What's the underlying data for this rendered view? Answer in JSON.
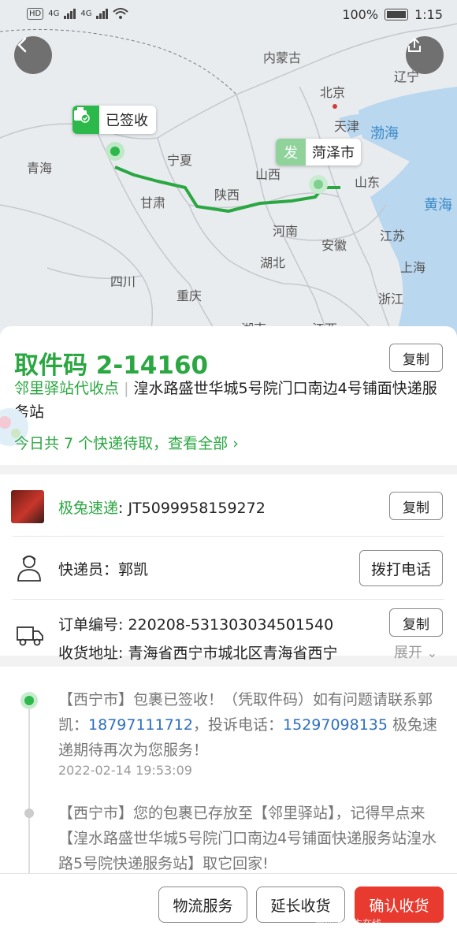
{
  "status_bar": {
    "network_left": "4G",
    "network_right": "4G",
    "battery": "100%",
    "time": "1:15"
  },
  "map": {
    "labels": {
      "neimenggu": "内蒙古",
      "beijing": "北京",
      "liaoning": "辽宁",
      "tianjin": "天津",
      "bohai": "渤海",
      "qinghai": "青海",
      "ningxia": "宁夏",
      "shanxi_jin": "山西",
      "shandong": "山东",
      "huanghai": "黄海",
      "gansu": "甘肃",
      "shaanxi": "陕西",
      "henan": "河南",
      "jiangsu": "江苏",
      "anhui": "安徽",
      "hubei": "湖北",
      "shanghai": "上海",
      "sichuan": "四川",
      "chongqing": "重庆",
      "zhejiang": "浙江",
      "hunan": "湖南",
      "jiangxi": "江西"
    },
    "signed_tag": "已签收",
    "from_tag_prefix": "发",
    "from_tag_city": "菏泽市",
    "route_color": "#2ba742"
  },
  "pickup": {
    "code_label": "取件码 2-14160",
    "copy_label": "复制",
    "station_prefix": "邻里驿站代收点",
    "station_sep": "|",
    "station_address": "湟水路盛世华城5号院门口南边4号铺面快递服务站",
    "today_text": "今日共 7 个快递待取，查看全部"
  },
  "courier": {
    "company": "极兔速递",
    "tracking_no": ": JT5099958159272",
    "copy_label": "复制",
    "courier_label": "快递员：郭凯",
    "call_label": "拨打电话",
    "order_label": "订单编号: 220208-531303034501540",
    "order_copy_label": "复制",
    "address_label": "收货地址: 青海省西宁市城北区青海省西宁",
    "expand_label": "展开"
  },
  "timeline": [
    {
      "text_before": "【西宁市】包裹已签收！（凭取件码）如有问题请联系郭凯：",
      "phone1": "18797111712",
      "text_mid": "，投诉电话：",
      "phone2": "15297098135",
      "text_after": " 极兔速递期待再次为您服务！",
      "time": "2022-02-14 19:53:09"
    },
    {
      "text": "【西宁市】您的包裹已存放至【邻里驿站】，记得早点来【湟水路盛世华城5号院门口南边4号铺面快递服务站湟水路5号院快递服务站】取它回家!"
    }
  ],
  "bottom_bar": {
    "logistics": "物流服务",
    "extend": "延长收货",
    "confirm": "确认收货",
    "watermark": "青海大学生在线"
  }
}
